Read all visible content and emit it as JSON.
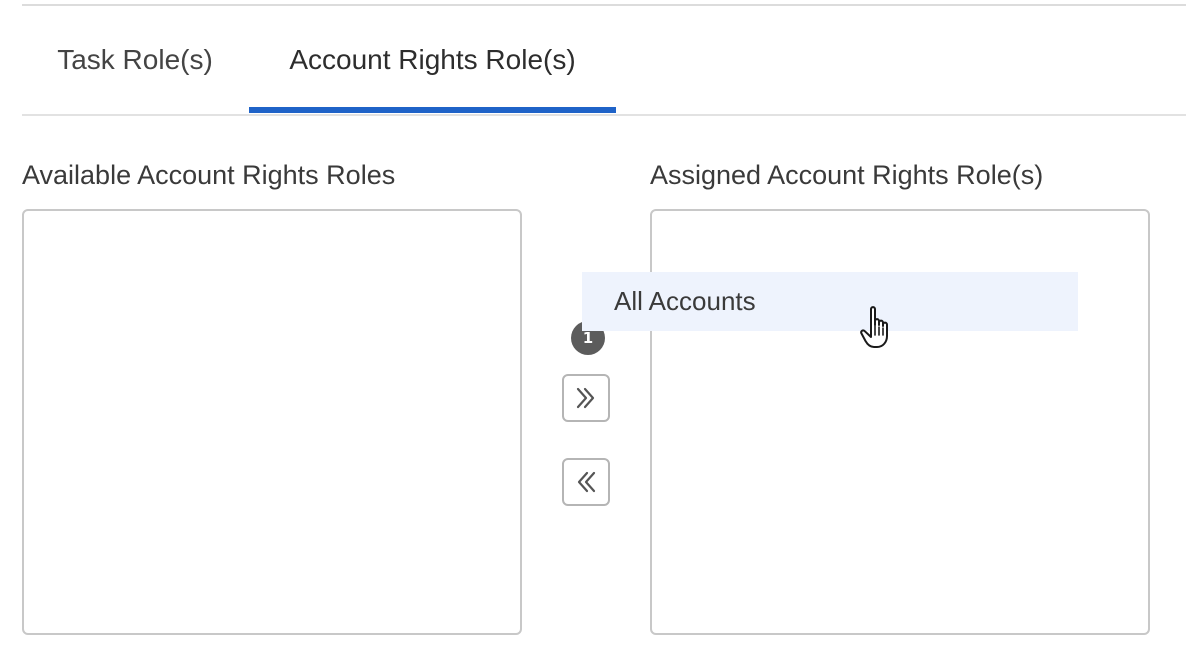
{
  "tabs": [
    {
      "label": "Task Role(s)",
      "active": false
    },
    {
      "label": "Account Rights Role(s)",
      "active": true
    }
  ],
  "colors": {
    "accent": "#1f63c8",
    "drag_highlight": "#eef3fd",
    "badge": "#5c5c5c"
  },
  "available_list": {
    "label": "Available Account Rights Roles",
    "items": []
  },
  "assigned_list": {
    "label": "Assigned Account Rights Role(s)",
    "items": []
  },
  "buttons": {
    "add_icon": "double-chevron-right-icon",
    "remove_icon": "double-chevron-left-icon"
  },
  "drag": {
    "item_label": "All Accounts",
    "count": "1",
    "cursor_icon": "hand-pointer-icon"
  }
}
